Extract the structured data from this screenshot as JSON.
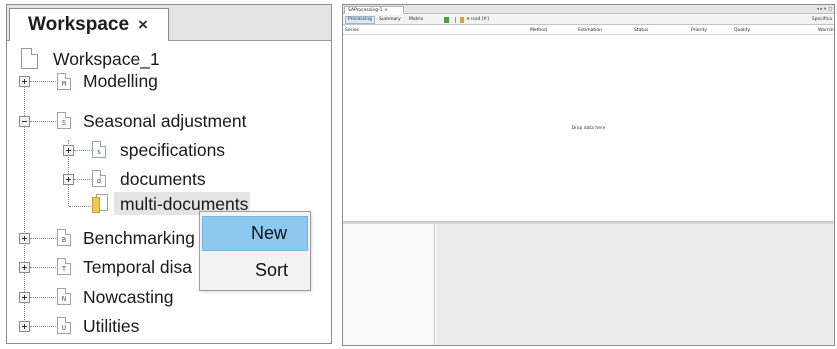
{
  "workspace_panel": {
    "tab_title": "Workspace",
    "close_glyph": "×",
    "root": "Workspace_1",
    "nodes": [
      {
        "label": "Modelling",
        "icon_letter": "M",
        "expanded": false
      },
      {
        "label": "Seasonal adjustment",
        "icon_letter": "S",
        "expanded": true
      },
      {
        "label": "specifications",
        "icon_letter": "s",
        "expanded": false
      },
      {
        "label": "documents",
        "icon_letter": "d",
        "expanded": false
      },
      {
        "label": "multi-documents",
        "icon": "folder-icon",
        "selected": true
      },
      {
        "label": "Benchmarking",
        "icon_letter": "B",
        "expanded": false
      },
      {
        "label": "Temporal disa",
        "icon_letter": "T",
        "expanded": false
      },
      {
        "label": "Nowcasting",
        "icon_letter": "N",
        "expanded": false
      },
      {
        "label": "Utilities",
        "icon_letter": "U",
        "expanded": false
      }
    ]
  },
  "context_menu": {
    "items": [
      {
        "label": "New",
        "highlighted": true
      },
      {
        "label": "Sort",
        "highlighted": false
      }
    ]
  },
  "document_window": {
    "doc_tab": "SAProcessing-1  ×",
    "window_controls": "◂ ▸ ▾ □",
    "view_tabs": [
      "Processing",
      "Summary",
      "Matrix"
    ],
    "toolbar_text": "▾ rsa4 [fr]",
    "right_label": "Specifica",
    "columns": [
      "Series",
      "Method",
      "Estimation",
      "Status",
      "Priority",
      "Quality",
      "Warning"
    ],
    "drop_hint": "Drop data here"
  },
  "colors": {
    "selection_blue": "#8cc8f0",
    "folder_yellow": "#f0c84a",
    "selected_row": "#e4e4e4"
  }
}
